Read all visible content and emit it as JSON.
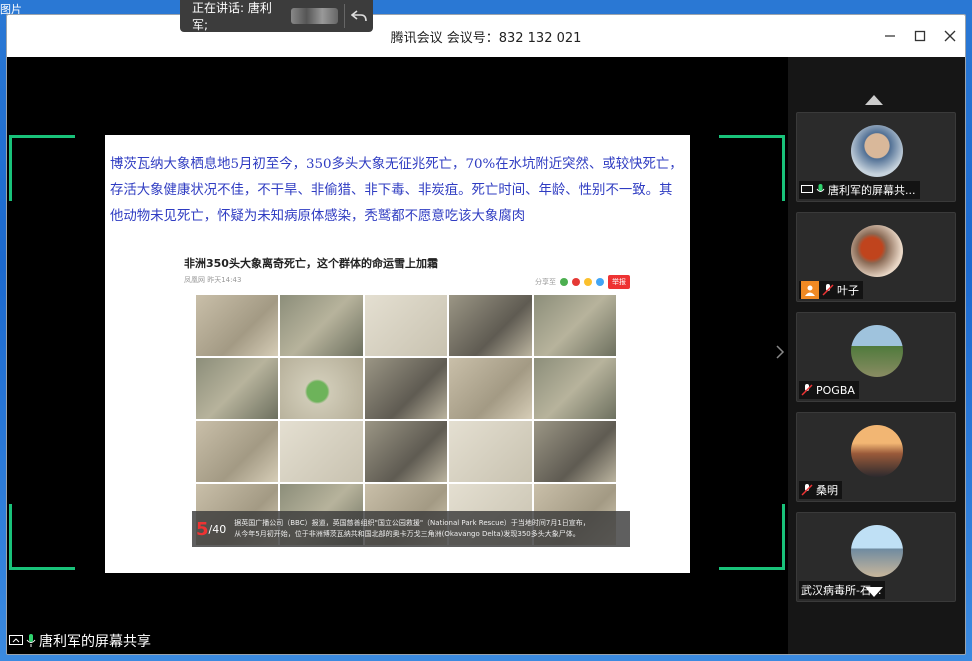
{
  "desktop": {
    "label": "图片"
  },
  "window": {
    "title": "腾讯会议 会议号：832 132 021"
  },
  "speaking": {
    "label": "正在讲话: 唐利军;"
  },
  "share": {
    "label": "唐利军的屏幕共享",
    "slide_text": "博茨瓦纳大象栖息地5月初至今，350多头大象无征兆死亡，70%在水坑附近突然、或较快死亡，存活大象健康状况不佳，不干旱、非偷猎、非下毒、非炭疽。死亡时间、年龄、性别不一致。其他动物未见死亡，怀疑为未知病原体感染，秃鹫都不愿意吃该大象腐肉",
    "article": {
      "title": "非洲350头大象离奇死亡，这个群体的命运雪上加霜",
      "meta": "凤凰网 昨天14:43",
      "share_label": "分享至",
      "report": "举报",
      "page_current": "5",
      "page_total": "/40",
      "caption_line1": "据英国广播公司（BBC）报道，英国慈善组织\"国立公园救援\"（National Park Rescue）于当地时间7月1日宣布，",
      "caption_line2": "从今年5月初开始，位于非洲博茨瓦纳共和国北部的奥卡万戈三角洲(Okavango Delta)发现350多头大象尸体。"
    }
  },
  "participants": [
    {
      "name": "唐利军的屏幕共..."
    },
    {
      "name": "叶子"
    },
    {
      "name": "POGBA"
    },
    {
      "name": "桑明"
    },
    {
      "name": "武汉病毒所-石..."
    }
  ],
  "colors": {
    "accent_green": "#19c27a",
    "slide_text": "#2f3cc2",
    "mic_green": "#2fd26e"
  }
}
